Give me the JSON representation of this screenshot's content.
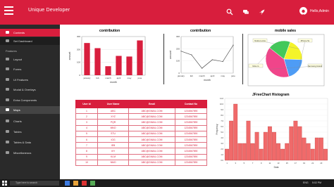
{
  "header": {
    "app_title": "Unique Developer",
    "user_name": "Hello,Admin",
    "icons": [
      "search-icon",
      "chat-icon",
      "rocket-icon",
      "user-avatar"
    ]
  },
  "sidebar": {
    "active_item": "Contents",
    "sections": {
      "features": "Features",
      "misc": ""
    },
    "items": [
      {
        "label": "Contents",
        "icon": "home-icon"
      },
      {
        "label": "Set Dashboard",
        "icon": "grid-icon"
      },
      {
        "label": "Layout",
        "icon": "layout-icon"
      },
      {
        "label": "Forms",
        "icon": "form-icon"
      },
      {
        "label": "UI Features",
        "icon": "ui-icon"
      },
      {
        "label": "Modal & Overlays",
        "icon": "modal-icon"
      },
      {
        "label": "Extra Components",
        "icon": "puzzle-icon"
      },
      {
        "label": "Maps",
        "icon": "map-icon"
      },
      {
        "label": "Charts",
        "icon": "chart-icon"
      },
      {
        "label": "Tables",
        "icon": "table-icon"
      },
      {
        "label": "Tables & Data",
        "icon": "data-icon"
      },
      {
        "label": "Miscellaneous",
        "icon": "misc-icon"
      }
    ]
  },
  "colors": {
    "accent": "#d81e3d",
    "sidebar_bg": "#2a2a2a",
    "bar_fill": "#d81e3d",
    "histogram_fill": "#f06a6a"
  },
  "table": {
    "headers": [
      "User Id",
      "User Name",
      "Email",
      "Contact No"
    ],
    "rows": [
      [
        "1",
        "ABC",
        "ABC@GMAIL.COM",
        "1234567890"
      ],
      [
        "2",
        "XYZ",
        "ABC@GMAIL.COM",
        "1234567890"
      ],
      [
        "3",
        "PQR",
        "ABC@GMAIL.COM",
        "1234567890"
      ],
      [
        "4",
        "MNO",
        "ABC@GMAIL.COM",
        "1234567890"
      ],
      [
        "5",
        "STU",
        "ABC@GMAIL.COM",
        "1234567890"
      ],
      [
        "6",
        "IOG",
        "ABC@GMAIL.COM",
        "1234567890"
      ],
      [
        "7",
        "IEB",
        "ABC@GMAIL.COM",
        "1234567890"
      ],
      [
        "8",
        "IXY",
        "ABC@GMAIL.COM",
        "1234567890"
      ],
      [
        "9",
        "KLM",
        "ABC@GMAIL.COM",
        "1234567890"
      ],
      [
        "10",
        "NMO",
        "ABC@GMAIL.COM",
        "1234567890"
      ]
    ]
  },
  "chart_data": [
    {
      "type": "bar",
      "title": "contribution",
      "xlabel": "month",
      "ylabel": "amount",
      "categories": [
        "january",
        "feb",
        "march",
        "april",
        "may",
        "june"
      ],
      "values": [
        250,
        210,
        70,
        150,
        145,
        270
      ],
      "ylim": [
        0,
        300
      ]
    },
    {
      "type": "line",
      "title": "contribution",
      "xlabel": "month",
      "ylabel": "amount",
      "categories": [
        "january",
        "feb",
        "march",
        "april",
        "may",
        "june"
      ],
      "values": [
        180,
        150,
        40,
        110,
        95,
        230
      ],
      "ylim": [
        0,
        300
      ]
    },
    {
      "type": "pie",
      "title": "mobile sales",
      "labels": [
        "Nokia Lumia",
        "iPhone 5s",
        "Samsung Grand",
        "Moto G"
      ],
      "values": [
        20,
        20,
        40,
        20
      ],
      "colors": [
        "#f4f42a",
        "#4e9cf5",
        "#f0458a",
        "#42c85a"
      ]
    },
    {
      "type": "bar",
      "title": "JFreeChart Histogram",
      "xlabel": "Data",
      "ylabel": "Frequency",
      "x": [
        1,
        2,
        3,
        4,
        5,
        6,
        7,
        8,
        9,
        10,
        11,
        12,
        13,
        14,
        15,
        16,
        17,
        18,
        19,
        20,
        21,
        22,
        23,
        24
      ],
      "values": [
        2,
        7,
        10,
        3,
        3,
        7,
        3,
        5,
        2,
        5,
        6,
        5,
        3,
        2,
        3,
        6,
        7,
        6,
        4,
        3,
        2,
        4,
        4,
        2
      ],
      "ylim": [
        0,
        11
      ]
    }
  ],
  "taskbar": {
    "search_placeholder": "Type here to search",
    "tray_lang": "ENG",
    "time": "5:02 PM",
    "date": "1/1/2020"
  }
}
